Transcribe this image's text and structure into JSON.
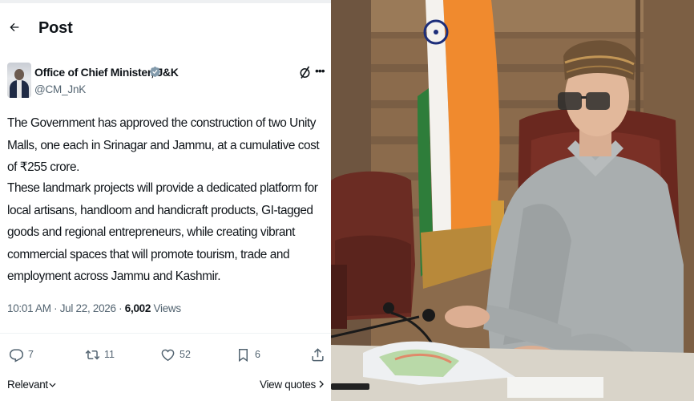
{
  "header": {
    "title": "Post"
  },
  "author": {
    "name": "Office of Chief Minister, J&K",
    "handle": "@CM_JnK"
  },
  "post": {
    "paragraph1": "The Government has approved the construction of two Unity Malls, one each in Srinagar and Jammu, at a cumulative cost of ₹255 crore.",
    "paragraph2": "These landmark projects will provide a dedicated platform for local artisans, handloom and handicraft products, GI-tagged goods and regional entrepreneurs, while creating vibrant commercial spaces that will promote tourism, trade and employment across Jammu and Kashmir.",
    "timestamp": "10:01 AM · Jul 22, 2026 · ",
    "views_count": "6,002",
    "views_label": " Views"
  },
  "actions": {
    "replies": "7",
    "reposts": "11",
    "likes": "52",
    "bookmarks": "6"
  },
  "footer": {
    "sort_label": "Relevant",
    "view_quotes_label": "View quotes"
  },
  "icons": {
    "back": "arrow-left-icon",
    "verified": "verified-badge-icon",
    "grok": "grok-icon",
    "more": "more-icon",
    "reply": "reply-icon",
    "repost": "repost-icon",
    "like": "heart-icon",
    "bookmark": "bookmark-icon",
    "share": "share-icon"
  },
  "colors": {
    "text": "#0f1419",
    "secondary": "#536471",
    "verified_badge": "#829aab"
  }
}
